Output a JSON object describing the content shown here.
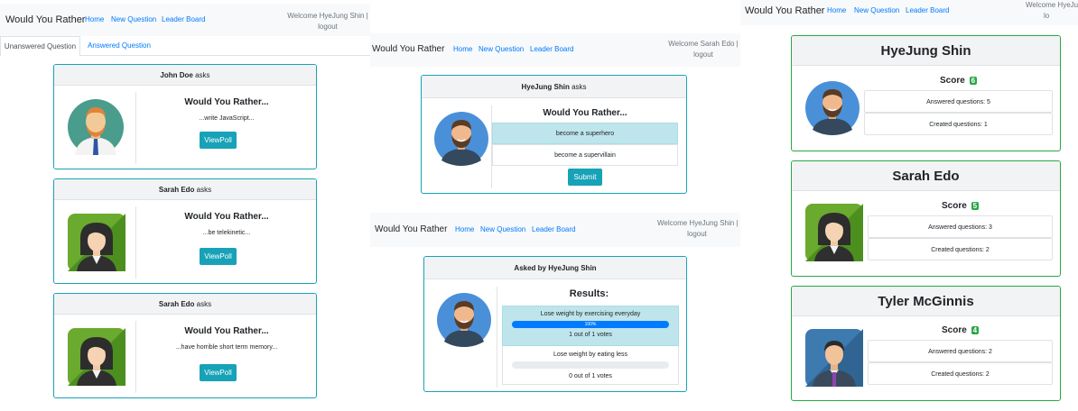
{
  "app": {
    "brand": "Would You Rather",
    "nav": {
      "home": "Home",
      "new_question": "New Question",
      "leader_board": "Leader Board"
    }
  },
  "panel1": {
    "welcome_line1": "Welcome HyeJung Shin |",
    "welcome_line2": "logout",
    "tabs": {
      "unanswered": "Unanswered Question",
      "answered": "Answered Question"
    },
    "questions": [
      {
        "author": "John Doe",
        "asks": "asks",
        "title": "Would You Rather...",
        "preview": "...write JavaScript...",
        "button": "ViewPoll"
      },
      {
        "author": "Sarah Edo",
        "asks": "asks",
        "title": "Would You Rather...",
        "preview": "...be telekinetic...",
        "button": "ViewPoll"
      },
      {
        "author": "Sarah Edo",
        "asks": "asks",
        "title": "Would You Rather...",
        "preview": "...have horrible short term memory...",
        "button": "ViewPoll"
      }
    ]
  },
  "panel2": {
    "welcome_line1": "Welcome Sarah Edo |",
    "welcome_line2": "logout",
    "author": "HyeJung Shin",
    "asks": "asks",
    "title": "Would You Rather...",
    "option_one": "become a superhero",
    "option_two": "become a supervillain",
    "submit": "Submit"
  },
  "panel3": {
    "welcome_line1": "Welcome HyeJung Shin |",
    "welcome_line2": "logout",
    "header": "Asked by HyeJung Shin",
    "results_title": "Results:",
    "option_one": {
      "text": "Lose weight by exercising everyday",
      "percent_label": "100%",
      "percent": 100,
      "votes": "1 out of 1 votes"
    },
    "option_two": {
      "text": "Lose weight by eating less",
      "percent": 0,
      "votes": "0 out of 1 votes"
    },
    "accent": "#007bff"
  },
  "panel4": {
    "welcome_line1": "Welcome HyeJu",
    "welcome_line2": "lo",
    "users": [
      {
        "name": "HyeJung Shin",
        "score_label": "Score",
        "score": "6",
        "answered": "Answered questions: 5",
        "created": "Created questions: 1"
      },
      {
        "name": "Sarah Edo",
        "score_label": "Score",
        "score": "5",
        "answered": "Answered questions: 3",
        "created": "Created questions: 2"
      },
      {
        "name": "Tyler McGinnis",
        "score_label": "Score",
        "score": "4",
        "answered": "Answered questions: 2",
        "created": "Created questions: 2"
      }
    ]
  },
  "icons": {
    "john": "avatar-man-blond-beard",
    "sarah": "avatar-woman-green-bg",
    "hyejung": "avatar-man-beard-blue-bg",
    "tyler": "avatar-man-suit-blue-bg"
  }
}
